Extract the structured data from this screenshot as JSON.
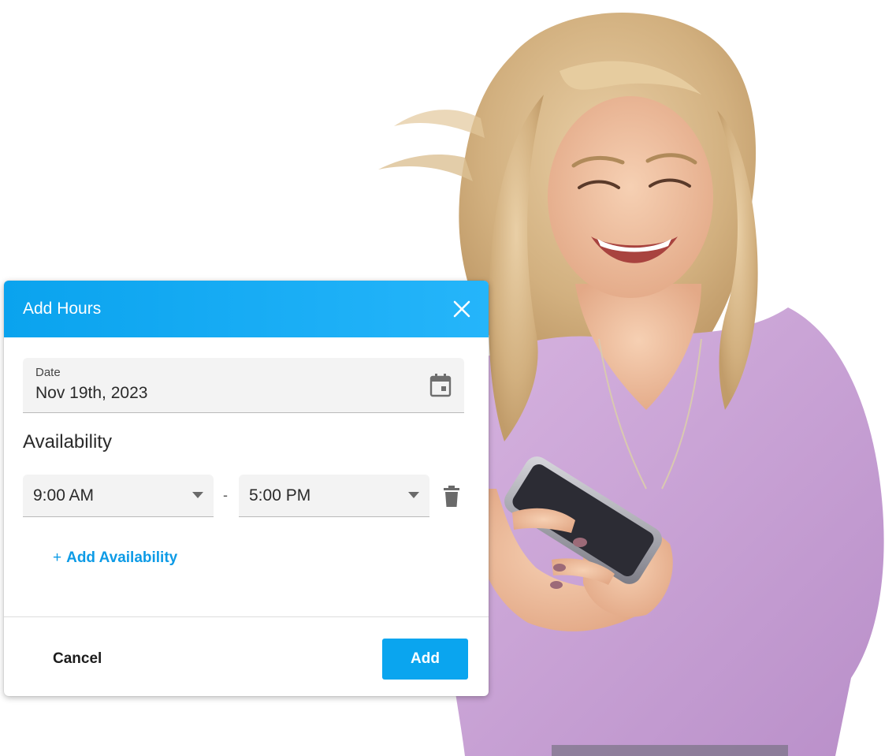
{
  "dialog": {
    "title": "Add Hours",
    "close_icon": "close-icon",
    "accent_color": "#0aa5ef"
  },
  "date_field": {
    "label": "Date",
    "value": "Nov 19th, 2023",
    "icon": "calendar-icon"
  },
  "availability": {
    "heading": "Availability",
    "start_time": "9:00 AM",
    "separator": "-",
    "end_time": "5:00 PM",
    "delete_icon": "trash-icon",
    "add_label": "Add Availability",
    "add_icon": "+"
  },
  "footer": {
    "cancel_label": "Cancel",
    "add_label": "Add"
  }
}
